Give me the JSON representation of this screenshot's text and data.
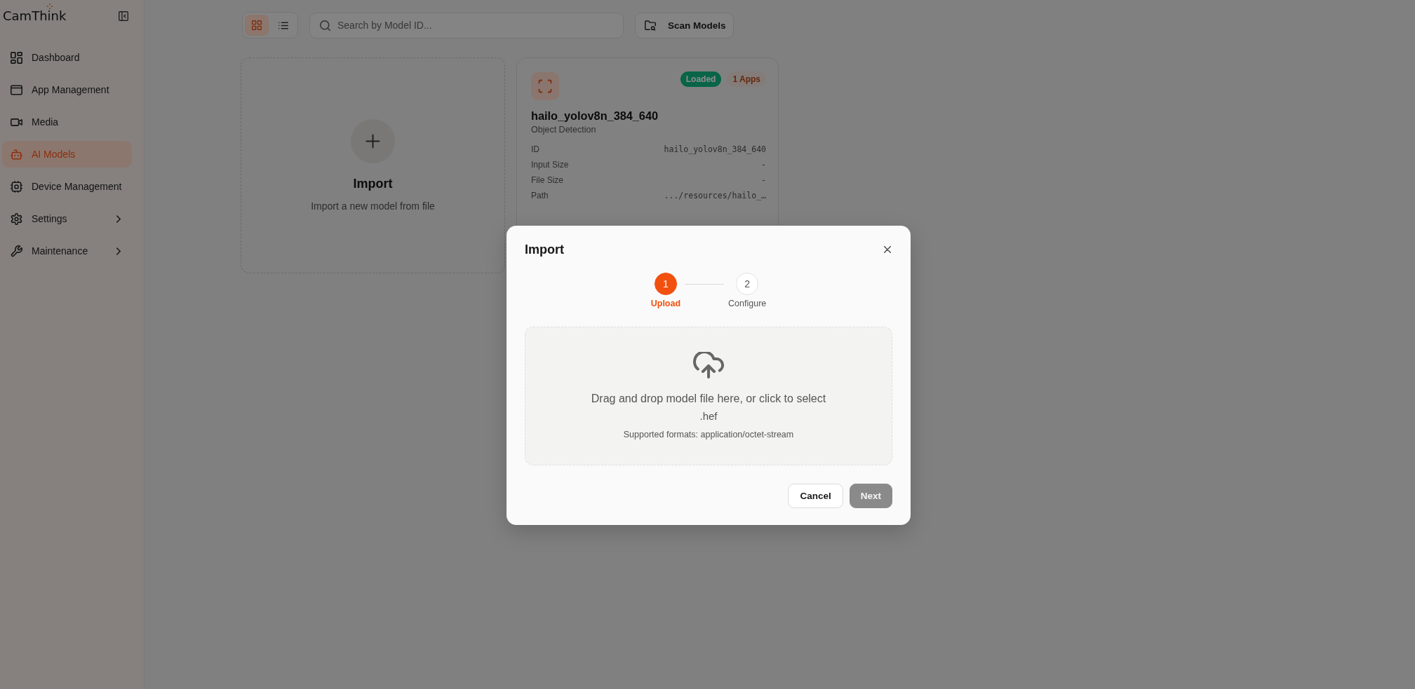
{
  "sidebar": {
    "logo": "CamThink",
    "items": [
      {
        "label": "Dashboard",
        "selected": false,
        "submenu": false
      },
      {
        "label": "App Management",
        "selected": false,
        "submenu": false
      },
      {
        "label": "Media",
        "selected": false,
        "submenu": false
      },
      {
        "label": "AI Models",
        "selected": true,
        "submenu": false
      },
      {
        "label": "Device Management",
        "selected": false,
        "submenu": false
      },
      {
        "label": "Settings",
        "selected": false,
        "submenu": true
      },
      {
        "label": "Maintenance",
        "selected": false,
        "submenu": true
      }
    ]
  },
  "toolbar": {
    "view_modes": [
      {
        "selected": true
      },
      {
        "selected": false
      }
    ],
    "search": {
      "placeholder": "Search by Model ID..."
    },
    "scan_button": "Scan Models"
  },
  "import_card": {
    "title": "Import",
    "description": "Import a new model from file"
  },
  "models": [
    {
      "name": "hailo_yolov8n_384_640",
      "type": "Object Detection",
      "status": "Loaded",
      "apps": "1 Apps",
      "details": [
        {
          "label": "ID",
          "value": "hailo_yolov8n_384_640"
        },
        {
          "label": "Input Size",
          "value": "-"
        },
        {
          "label": "File Size",
          "value": "-"
        },
        {
          "label": "Path",
          "value": ".../resources/hailo_…"
        }
      ]
    }
  ],
  "dialog": {
    "title": "Import",
    "steps": [
      {
        "number": "1",
        "label": "Upload",
        "selected": true
      },
      {
        "number": "2",
        "label": "Configure",
        "selected": false
      }
    ],
    "dropzone": {
      "prompt": "Drag and drop model file here, or click to select",
      "extension": ".hef",
      "formats": "Supported formats: application/octet-stream"
    },
    "buttons": [
      {
        "label": "Cancel",
        "kind": "secondary",
        "disabled": false
      },
      {
        "label": "Next",
        "kind": "primary",
        "disabled": true
      }
    ]
  }
}
